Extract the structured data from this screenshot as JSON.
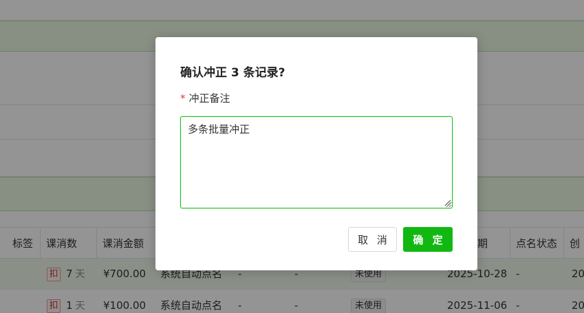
{
  "dialog": {
    "title": "确认冲正 3 条记录?",
    "field_label": "冲正备注",
    "required_mark": "*",
    "remark_value": "多条批量冲正",
    "cancel_label": "取 消",
    "confirm_label": "确 定"
  },
  "table": {
    "columns": [
      "标签",
      "课消数",
      "课消金额",
      "期",
      "点名状态",
      "创"
    ],
    "rows": [
      {
        "tag": "扣",
        "count": "7",
        "unit": "天",
        "amount": "¥700.00",
        "source": "系统自动点名",
        "col_a": "-",
        "col_b": "-",
        "usage": "未使用",
        "date": "2025-10-28",
        "status": "-",
        "created": "20"
      },
      {
        "tag": "扣",
        "count": "1",
        "unit": "天",
        "amount": "¥100.00",
        "source": "系统自动点名",
        "col_a": "-",
        "col_b": "-",
        "usage": "未使用",
        "date": "2025-11-06",
        "status": "-",
        "created": "20"
      }
    ]
  },
  "colors": {
    "accent": "#12b812",
    "required": "#e4393c",
    "highlight_row": "#eef7e8",
    "overlay": "rgba(0,0,0,0.42)"
  }
}
